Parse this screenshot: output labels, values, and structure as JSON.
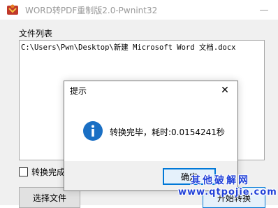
{
  "window": {
    "title": "WORD转PDF重制版2.0-Pwnint32",
    "minimize_glyph": "—"
  },
  "main": {
    "file_list_label": "文件列表",
    "file_list": [
      "C:\\Users\\Pwn\\Desktop\\新建 Microsoft Word 文档.docx"
    ],
    "checkbox_label": "转换完成",
    "checkbox_checked": false,
    "select_button_label": "选择文件",
    "start_button_label": "开始转换"
  },
  "dialog": {
    "title": "提示",
    "close_glyph": "✕",
    "message": "转换完毕，耗时:0.0154241秒",
    "ok_label": "确定"
  },
  "watermark": {
    "line1": "其他破解网",
    "line2": "www.qtpojie.com"
  },
  "colors": {
    "accent": "#0078d7",
    "info_icon": "#1a6fc4",
    "watermark": "#1f3fd8"
  }
}
